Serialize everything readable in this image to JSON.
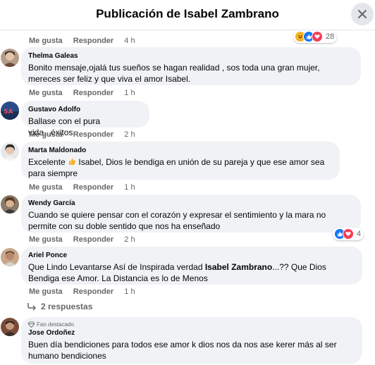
{
  "header": {
    "title": "Publicación de Isabel Zambrano"
  },
  "labels": {
    "like": "Me gusta",
    "reply": "Responder"
  },
  "top_row": {
    "time": "4 h",
    "reaction_count": "28"
  },
  "comments": [
    {
      "name": "Thelma Galeas",
      "text": "Bonito mensaje,ojalá tus sueños se hagan realidad , sos toda una gran mujer, mereces ser feliz y que viva el amor Isabel.",
      "time": "1 h"
    },
    {
      "name": "Gustavo Adolfo",
      "text": "Ballase con el pura vida...éxitos",
      "time": "2 h"
    },
    {
      "name": "Marta Maldonado",
      "text_before": "Excelente ",
      "text_after": " Isabel, Dios le bendiga en unión de su pareja y que ese amor sea para siempre",
      "time": "1 h"
    },
    {
      "name": "Wendy García",
      "text": "Cuando se quiere pensar con el corazón y expresar el sentimiento y la mara no permite con su doble sentido que nos ha enseñado",
      "time": "2 h",
      "reaction_count": "4"
    },
    {
      "name": "Ariel Ponce",
      "text_before": "Que Lindo Levantarse Así de Inspirada verdad ",
      "text_bold": "Isabel Zambrano",
      "text_after": "...?? Que Dios Bendiga ese Amor. La Distancia es lo de Menos",
      "time": "1 h",
      "replies": "2 respuestas"
    },
    {
      "badge": "Fan destacado",
      "name": "Jose Ordoñez",
      "text": "Buen día bendiciones para todos ese amor k dios nos da nos ase kerer más al ser humano bendiciones"
    }
  ],
  "colors": {
    "like_blue": "#1877f2",
    "love_red": "#f33e58",
    "haha_yellow": "#f7b125",
    "bubble": "#f0f2f5",
    "meta": "#65676b"
  }
}
